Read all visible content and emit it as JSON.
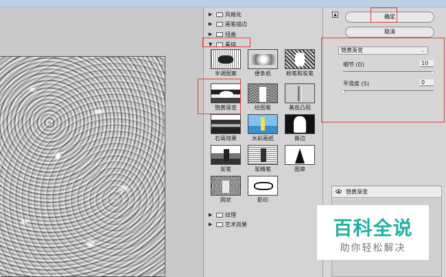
{
  "filters": {
    "categories_top": [
      "风格化",
      "画笔描边",
      "扭曲"
    ],
    "open_category": "素描",
    "thumbs": [
      {
        "label": "半调图案"
      },
      {
        "label": "便条纸"
      },
      {
        "label": "粉笔和炭笔"
      },
      {
        "label": "铬黄渐变"
      },
      {
        "label": "绘图笔"
      },
      {
        "label": "基底凸现"
      },
      {
        "label": "石膏效果"
      },
      {
        "label": "水彩画纸"
      },
      {
        "label": "撕边"
      },
      {
        "label": "炭笔"
      },
      {
        "label": "炭精笔"
      },
      {
        "label": "图章"
      },
      {
        "label": "网状"
      },
      {
        "label": "影印"
      }
    ],
    "categories_bottom": [
      "纹理",
      "艺术效果"
    ]
  },
  "options": {
    "ok_label": "确定",
    "cancel_label": "取消",
    "selected_filter": "铬黄渐变",
    "params": [
      {
        "label": "细节 (D)",
        "value": "10",
        "level": 1.0
      },
      {
        "label": "平滑度 (S)",
        "value": "0",
        "level": 0.0
      }
    ],
    "layer_name": "铬黄渐变"
  },
  "watermark": {
    "main": "百科全说",
    "sub": "助你轻松解决"
  },
  "colors": {
    "annotation": "#e43a3a",
    "watermark_teal": "#1fb1a3"
  }
}
